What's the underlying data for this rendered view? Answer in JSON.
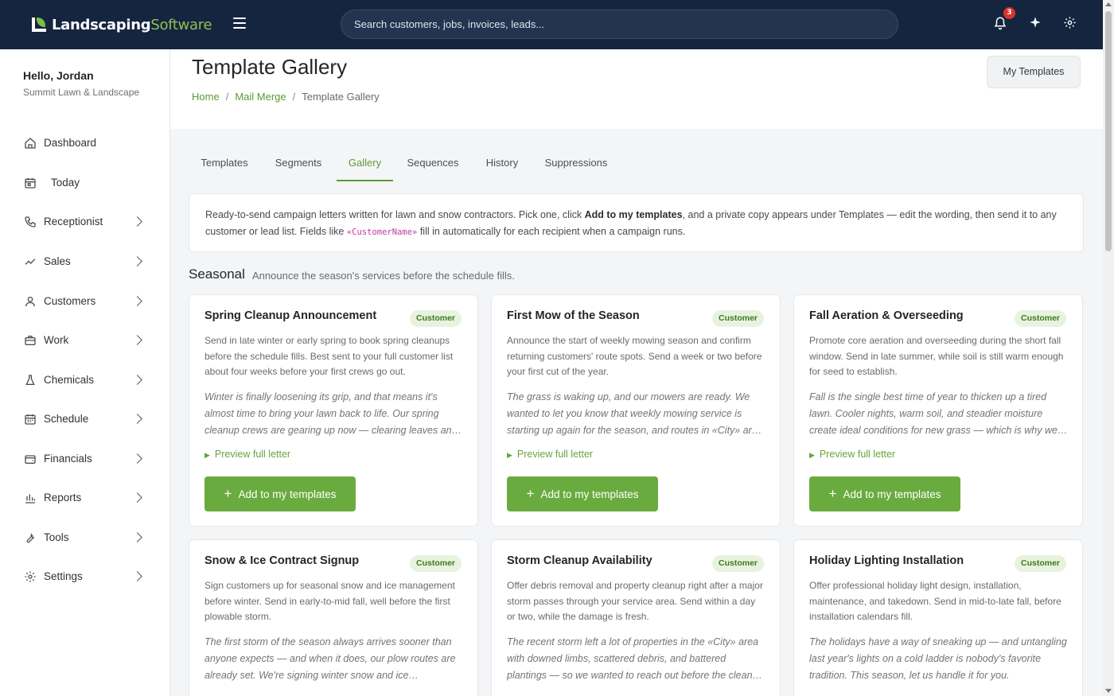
{
  "app": {
    "logo_primary": "Landscaping",
    "logo_secondary": "Software",
    "search_placeholder": "Search customers, jobs, invoices, leads...",
    "notification_count": "3"
  },
  "sidebar": {
    "greeting": "Hello, Jordan",
    "company": "Summit Lawn & Landscape",
    "items": [
      {
        "label": "Dashboard",
        "icon": "home-icon",
        "expandable": false
      },
      {
        "label": "Today",
        "icon": "calendar-day-icon",
        "expandable": false
      },
      {
        "label": "Receptionist",
        "icon": "phone-icon",
        "expandable": true
      },
      {
        "label": "Sales",
        "icon": "trend-icon",
        "expandable": true
      },
      {
        "label": "Customers",
        "icon": "user-icon",
        "expandable": true
      },
      {
        "label": "Work",
        "icon": "briefcase-icon",
        "expandable": true
      },
      {
        "label": "Chemicals",
        "icon": "flask-icon",
        "expandable": true
      },
      {
        "label": "Schedule",
        "icon": "calendar-grid-icon",
        "expandable": true
      },
      {
        "label": "Financials",
        "icon": "wallet-icon",
        "expandable": true
      },
      {
        "label": "Reports",
        "icon": "bar-chart-icon",
        "expandable": true
      },
      {
        "label": "Tools",
        "icon": "wrench-icon",
        "expandable": true
      },
      {
        "label": "Settings",
        "icon": "gear-icon",
        "expandable": true
      }
    ]
  },
  "header": {
    "title": "Template Gallery",
    "breadcrumb": [
      "Home",
      "Mail Merge",
      "Template Gallery"
    ],
    "my_templates_button": "My Templates"
  },
  "tabs": [
    "Templates",
    "Segments",
    "Gallery",
    "Sequences",
    "History",
    "Suppressions"
  ],
  "active_tab": "Gallery",
  "info": {
    "text_1": "Ready-to-send campaign letters written for lawn and snow contractors. Pick one, click ",
    "bold": "Add to my templates",
    "text_2": ", and a private copy appears under Templates — edit the wording, then send it to any customer or lead list. Fields like ",
    "code": "«CustomerName»",
    "text_3": " fill in automatically for each recipient when a campaign runs."
  },
  "section": {
    "title": "Seasonal",
    "subtitle": "Announce the season's services before the schedule fills."
  },
  "card_labels": {
    "preview": "Preview full letter",
    "add": "Add to my templates"
  },
  "cards": [
    {
      "title": "Spring Cleanup Announcement",
      "tag": "Customer",
      "description": "Send in late winter or early spring to book spring cleanups before the schedule fills. Best sent to your full customer list about four weeks before your first crews go out.",
      "excerpt": "Winter is finally loosening its grip, and that means it's almost time to bring your lawn back to life. Our spring cleanup crews are gearing up now — clearing leaves an…"
    },
    {
      "title": "First Mow of the Season",
      "tag": "Customer",
      "description": "Announce the start of weekly mowing season and confirm returning customers' route spots. Send a week or two before your first cut of the year.",
      "excerpt": "The grass is waking up, and our mowers are ready. We wanted to let you know that weekly mowing service is starting up again for the season, and routes in «City» ar…"
    },
    {
      "title": "Fall Aeration & Overseeding",
      "tag": "Customer",
      "description": "Promote core aeration and overseeding during the short fall window. Send in late summer, while soil is still warm enough for seed to establish.",
      "excerpt": "Fall is the single best time of year to thicken up a tired lawn. Cooler nights, warm soil, and steadier moisture create ideal conditions for new grass — which is why we…"
    },
    {
      "title": "Snow & Ice Contract Signup",
      "tag": "Customer",
      "description": "Sign customers up for seasonal snow and ice management before winter. Send in early-to-mid fall, well before the first plowable storm.",
      "excerpt": "The first storm of the season always arrives sooner than anyone expects — and when it does, our plow routes are already set. We're signing winter snow and ice…"
    },
    {
      "title": "Storm Cleanup Availability",
      "tag": "Customer",
      "description": "Offer debris removal and property cleanup right after a major storm passes through your service area. Send within a day or two, while the damage is fresh.",
      "excerpt": "The recent storm left a lot of properties in the «City» area with downed limbs, scattered debris, and battered plantings — so we wanted to reach out before the clean…"
    },
    {
      "title": "Holiday Lighting Installation",
      "tag": "Customer",
      "description": "Offer professional holiday light design, installation, maintenance, and takedown. Send in mid-to-late fall, before installation calendars fill.",
      "excerpt": "The holidays have a way of sneaking up — and untangling last year's lights on a cold ladder is nobody's favorite tradition. This season, let us handle it for you."
    }
  ],
  "colors": {
    "topbar": "#15253f",
    "accent_green": "#6aab3f",
    "link_green": "#5d9a35",
    "badge_red": "#d9342b",
    "code_pink": "#c0399f"
  }
}
